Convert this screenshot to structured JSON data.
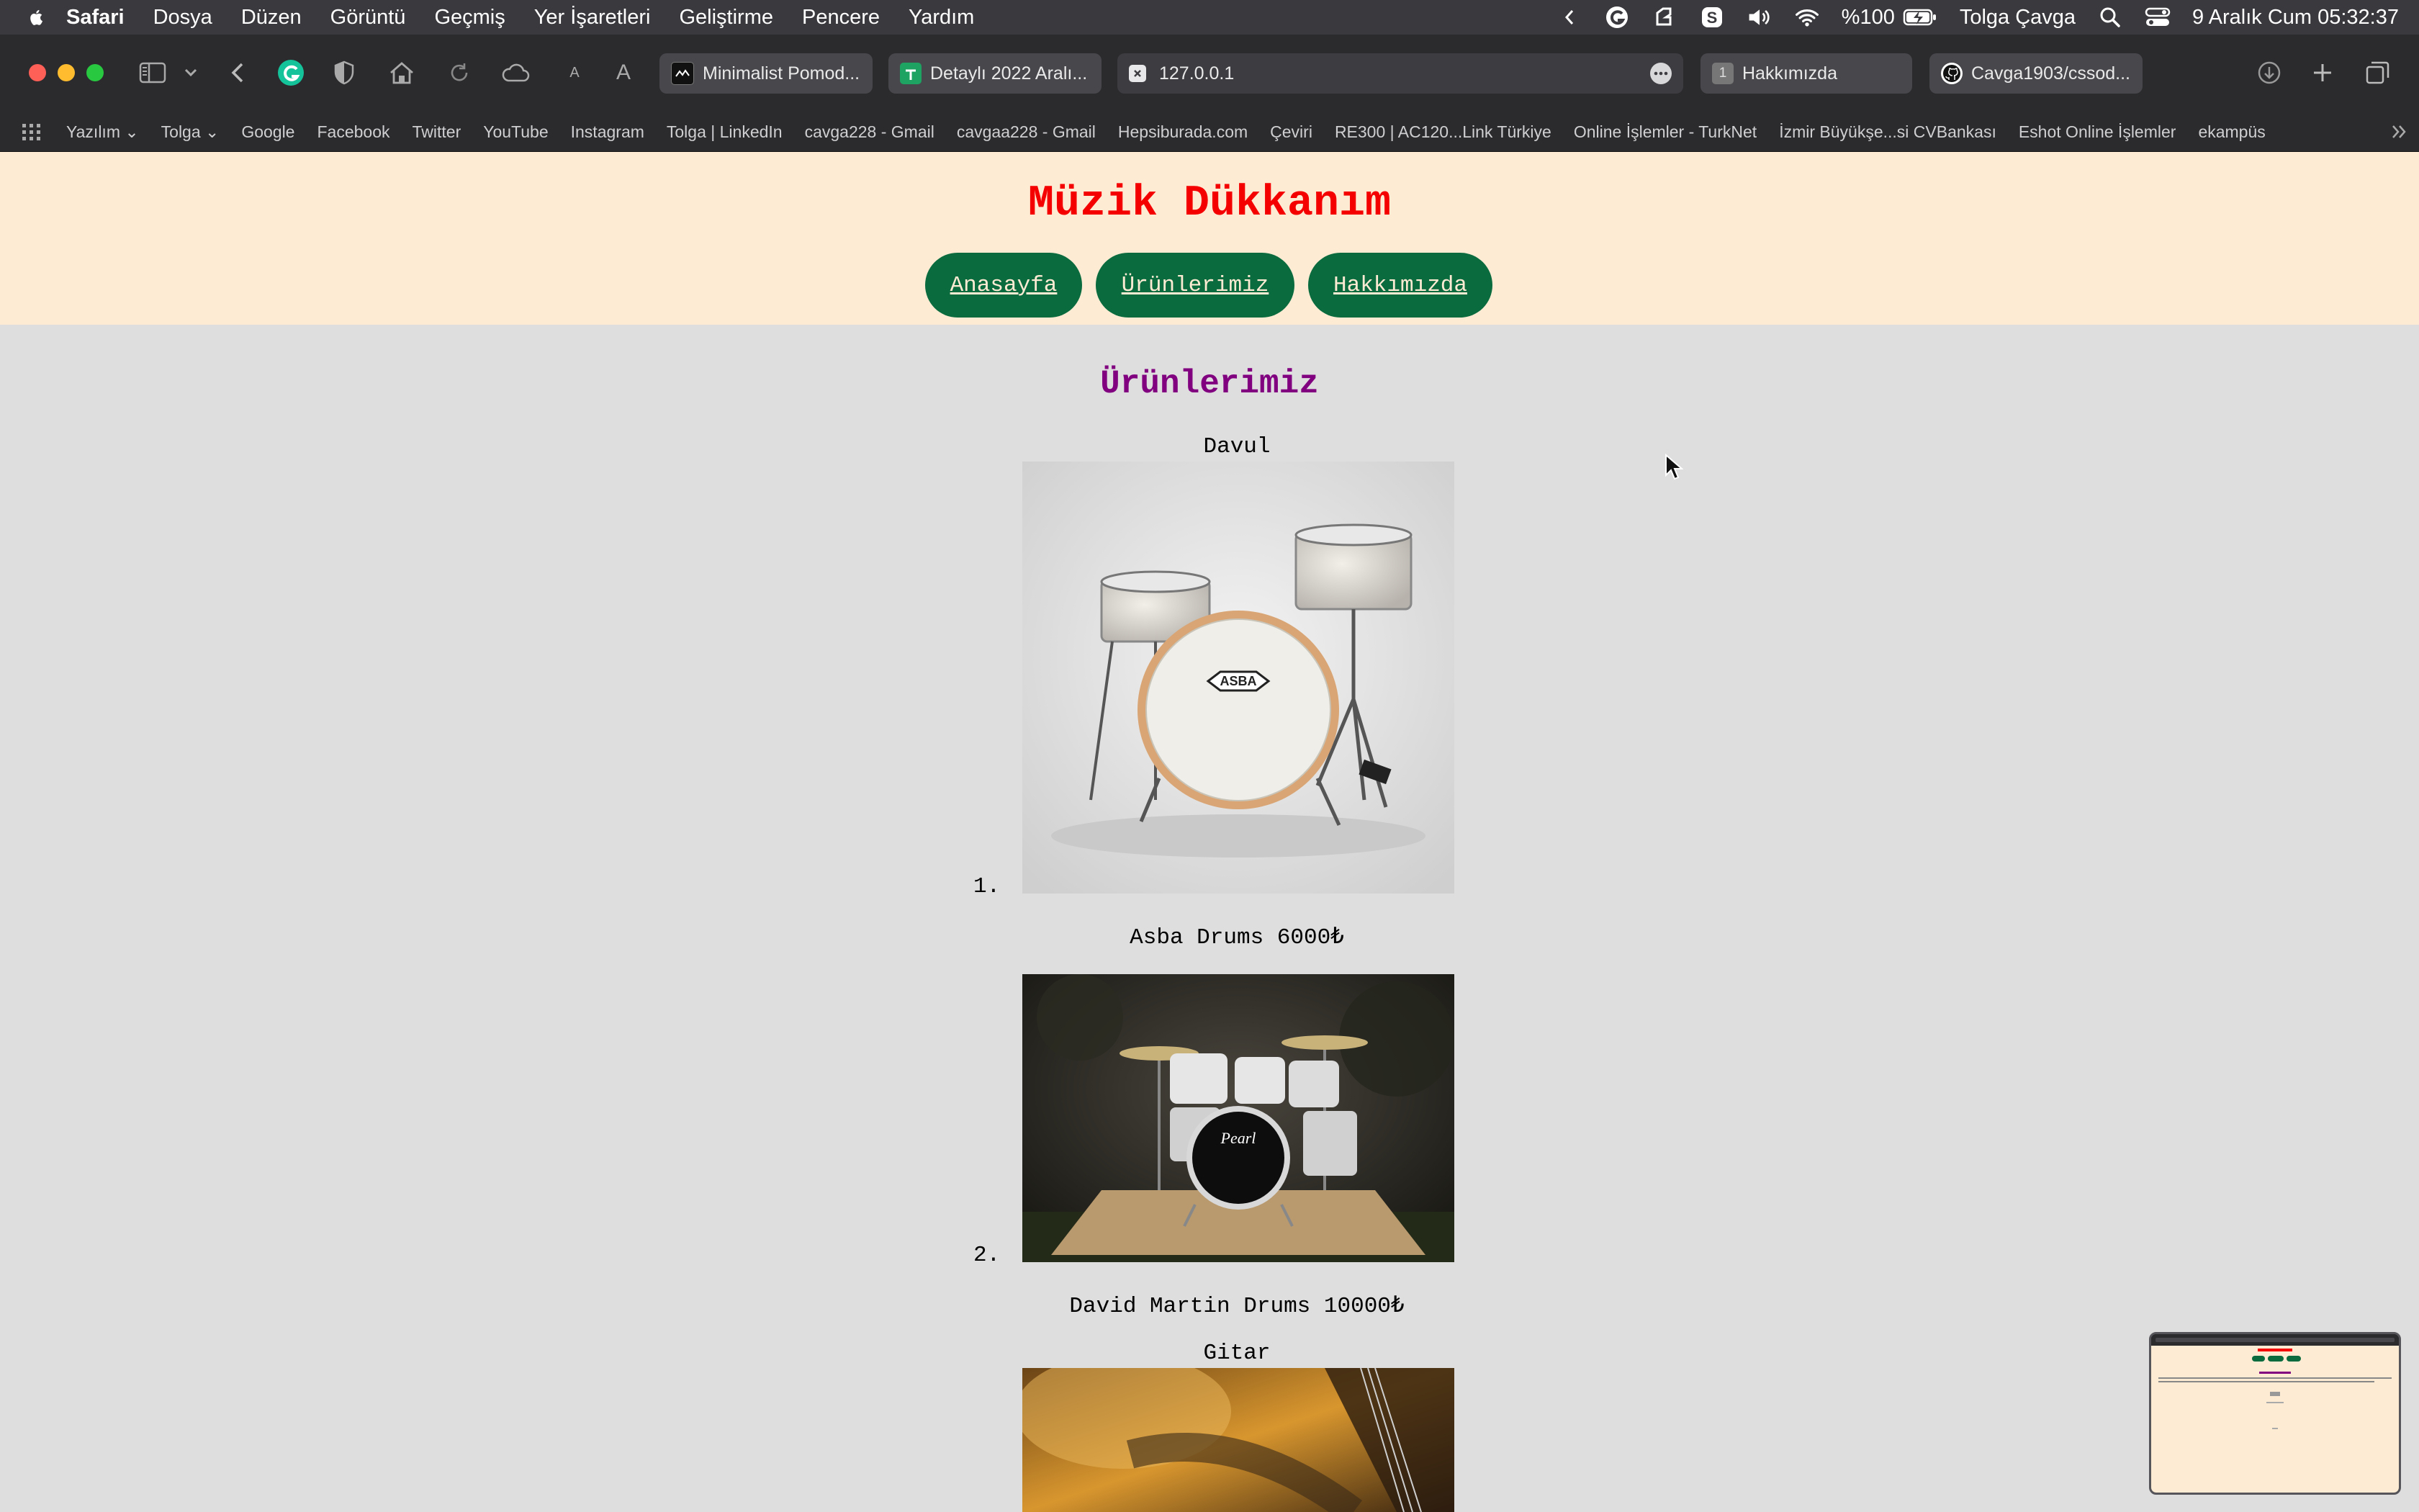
{
  "menubar": {
    "app": "Safari",
    "items": [
      "Dosya",
      "Düzen",
      "Görüntü",
      "Geçmiş",
      "Yer İşaretleri",
      "Geliştirme",
      "Pencere",
      "Yardım"
    ],
    "battery": "%100",
    "user": "Tolga Çavga",
    "datetime": "9 Aralık Cum  05:32:37"
  },
  "toolbar": {
    "tabs": [
      {
        "title": "Minimalist Pomod..."
      },
      {
        "title": "Detaylı 2022 Aralı..."
      },
      {
        "title": "127.0.0.1"
      },
      {
        "title": "Hakkımızda",
        "badge": "1"
      },
      {
        "title": "Cavga1903/cssod..."
      }
    ]
  },
  "bookmarks": [
    "Yazılım",
    "Tolga",
    "Google",
    "Facebook",
    "Twitter",
    "YouTube",
    "Instagram",
    "Tolga | LinkedIn",
    "cavga228 - Gmail",
    "cavgaa228 - Gmail",
    "Hepsiburada.com",
    "Çeviri",
    "RE300 | AC120...Link Türkiye",
    "Online İşlemler - TurkNet",
    "İzmir Büyükşe...si CVBankası",
    "Eshot Online İşlemler",
    "ekampüs"
  ],
  "site": {
    "title": "Müzik Dükkanım",
    "nav": [
      "Anasayfa",
      "Ürünlerimiz",
      "Hakkımızda"
    ],
    "heading": "Ürünlerimiz",
    "category1": "Davul",
    "items": [
      {
        "number": "1.",
        "caption": "Asba Drums 6000₺"
      },
      {
        "number": "2.",
        "caption": "David Martin Drums 10000₺"
      }
    ],
    "category2": "Gitar"
  },
  "colors": {
    "header_bg": "#fdebd3",
    "title": "#f40000",
    "nav_bg": "#0a6b3f",
    "heading": "#800080",
    "page_bg": "#dedede"
  }
}
